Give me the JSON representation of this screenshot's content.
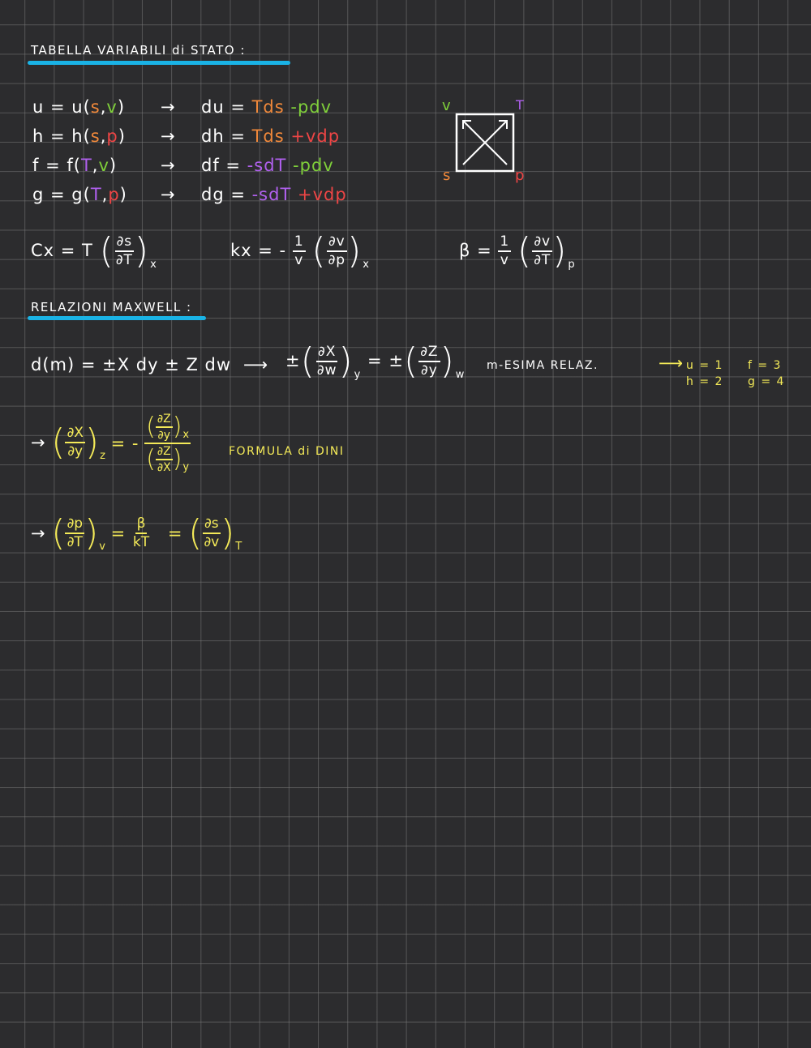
{
  "section1": {
    "title": "TABELLA   VARIABILI  di  STATO :",
    "underline_color": "#1ab3e6"
  },
  "potentials": [
    {
      "lhs": "u = u(",
      "args_s": "s",
      "sep": ",",
      "args_v": "v",
      "close": ")",
      "arrow": "→",
      "d": "du = ",
      "t1": "Tds",
      "t2": " -pdv"
    },
    {
      "lhs": "h = h(",
      "args_s": "s",
      "sep": ",",
      "args_v": "p",
      "close": ")",
      "arrow": "→",
      "d": "dh = ",
      "t1": "Tds",
      "t2": " +vdp"
    },
    {
      "lhs": "f = f(",
      "args_s": "T",
      "sep": ",",
      "args_v": "v",
      "close": ")",
      "arrow": "→",
      "d": "df = ",
      "t1": "-sdT",
      "t2": " -pdv"
    },
    {
      "lhs": "g = g(",
      "args_s": "T",
      "sep": ",",
      "args_v": "p",
      "close": ")",
      "arrow": "→",
      "d": "dg = ",
      "t1": "-sdT",
      "t2": " +vdp"
    }
  ],
  "square": {
    "top_left": "v",
    "top_right": "T",
    "bottom_left": "s",
    "bottom_right": "p"
  },
  "coeffs": {
    "cx_lhs": "Cx = T",
    "cx_num": "∂s",
    "cx_den": "∂T",
    "cx_sub": "x",
    "kx_lhs": "kx = -",
    "kx_frac_num": "1",
    "kx_frac_den": "v",
    "kx_num": "∂v",
    "kx_den": "∂p",
    "kx_sub": "x",
    "beta_lhs": "β =",
    "beta_frac_num": "1",
    "beta_frac_den": "v",
    "beta_num": "∂v",
    "beta_den": "∂T",
    "beta_sub": "p"
  },
  "section2": {
    "title": "RELAZIONI   MAXWELL :",
    "underline_color": "#1ab3e6"
  },
  "maxwell": {
    "lhs": "d(m) = ±X dy  ± Z dw",
    "arrow": "⟶",
    "pm1": "±",
    "num1": "∂X",
    "den1": "∂w",
    "sub1": "y",
    "eq": "=",
    "pm2": "±",
    "num2": "∂Z",
    "den2": "∂y",
    "sub2": "w",
    "label": "m-ESIMA   RELAZ.",
    "arrow2": "⟶",
    "u": "u = 1",
    "h": "h = 2",
    "f": "f = 3",
    "g": "g = 4"
  },
  "triple": {
    "arrow": "→",
    "num": "∂X",
    "den": "∂y",
    "sub": "z",
    "eq": "= -",
    "top_num": "∂Z",
    "top_den": "∂y",
    "top_sub": "x",
    "bot_num": "∂Z",
    "bot_den": "∂X",
    "bot_sub": "y",
    "label": "FORMULA   di   DINI"
  },
  "final": {
    "arrow": "→",
    "num": "∂p",
    "den": "∂T",
    "sub": "v",
    "eq1": "=",
    "beta": "β",
    "kt": "kT",
    "eq2": "=",
    "num2": "∂s",
    "den2": "∂v",
    "sub2": "T"
  }
}
